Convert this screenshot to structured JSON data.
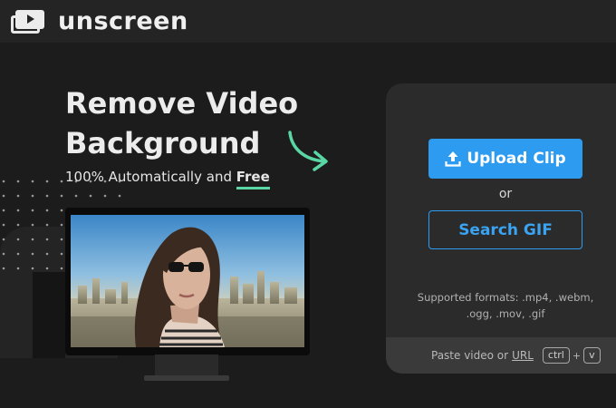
{
  "header": {
    "logo_icon": "video-layers-icon",
    "brand": "unscreen"
  },
  "hero": {
    "title": "Remove Video Background",
    "subtitle_prefix": "100% Automatically and ",
    "subtitle_emphasis": "Free",
    "arrow_icon": "curved-arrow-icon"
  },
  "preview": {
    "description": "video-preview-monitor"
  },
  "upload_panel": {
    "upload_label": "Upload Clip",
    "upload_icon": "upload-icon",
    "or_label": "or",
    "search_label": "Search GIF",
    "formats_text": "Supported formats: .mp4, .webm, .ogg, .mov, .gif",
    "paste_text": "Paste video or",
    "paste_link": "URL",
    "key_ctrl": "ctrl",
    "key_plus": "+",
    "key_v": "v"
  },
  "colors": {
    "accent": "#2d9bf0",
    "highlight": "#59d6a4",
    "background": "#1c1c1c",
    "panel": "#2b2b2b"
  }
}
